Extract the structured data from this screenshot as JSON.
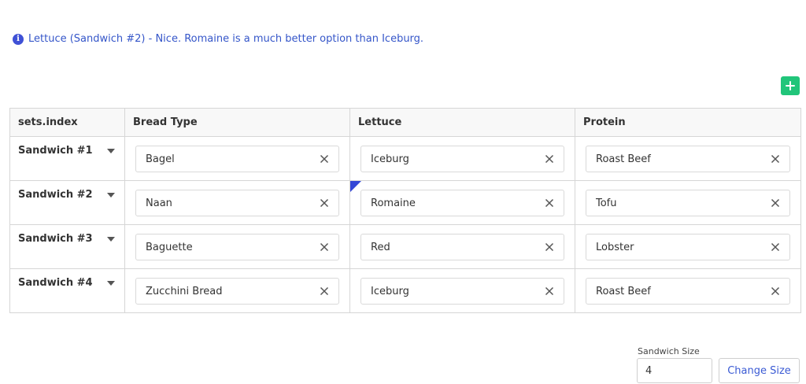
{
  "info": {
    "icon": "info-icon",
    "text": "Lettuce (Sandwich #2) - Nice. Romaine is a much better option than Iceburg."
  },
  "add_button": {
    "icon": "plus-icon",
    "color": "#21c57a"
  },
  "table": {
    "headers": [
      "sets.index",
      "Bread Type",
      "Lettuce",
      "Protein"
    ],
    "rows": [
      {
        "label": "Sandwich #1",
        "bread": "Bagel",
        "lettuce": "Iceburg",
        "protein": "Roast Beef"
      },
      {
        "label": "Sandwich #2",
        "bread": "Naan",
        "lettuce": "Romaine",
        "protein": "Tofu"
      },
      {
        "label": "Sandwich #3",
        "bread": "Baguette",
        "lettuce": "Red",
        "protein": "Lobster"
      },
      {
        "label": "Sandwich #4",
        "bread": "Zucchini Bread",
        "lettuce": "Iceburg",
        "protein": "Roast Beef"
      }
    ]
  },
  "size_control": {
    "label": "Sandwich Size",
    "value": "4",
    "button_label": "Change Size"
  },
  "colors": {
    "accent": "#3f51d6",
    "flag": "#3347d6",
    "link_text": "#3b5bd4"
  }
}
